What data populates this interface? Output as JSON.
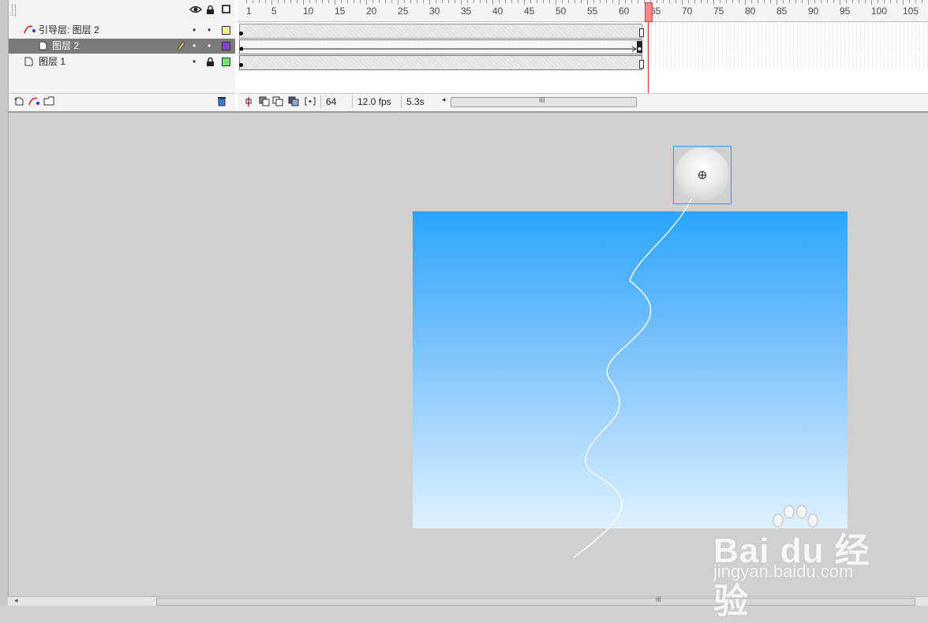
{
  "timeline": {
    "ruler_numbers": [
      "1",
      "5",
      "10",
      "15",
      "20",
      "25",
      "30",
      "35",
      "40",
      "45",
      "50",
      "55",
      "60",
      "65",
      "70",
      "75",
      "80",
      "85",
      "90",
      "95",
      "100",
      "105"
    ],
    "current_frame": "64",
    "frame_rate": "12.0 fps",
    "elapsed_time": "5.3s",
    "scroll_grip": "III",
    "layers": [
      {
        "name": "引导层: 图层 2",
        "type": "guide",
        "color": "#f5f07a",
        "selected": false
      },
      {
        "name": "图层 2",
        "type": "normal",
        "color": "#8a3fd6",
        "selected": true
      },
      {
        "name": "图层 1",
        "type": "normal",
        "color": "#6ee66e",
        "selected": false,
        "locked": true
      }
    ]
  },
  "stage": {
    "gradient_top": "#2aa5fc",
    "gradient_bottom": "#dff1ff"
  },
  "bottom_scroll_grip": "III",
  "watermark": {
    "brand": "Bai du 经验",
    "url": "jingyan.baidu.com"
  }
}
